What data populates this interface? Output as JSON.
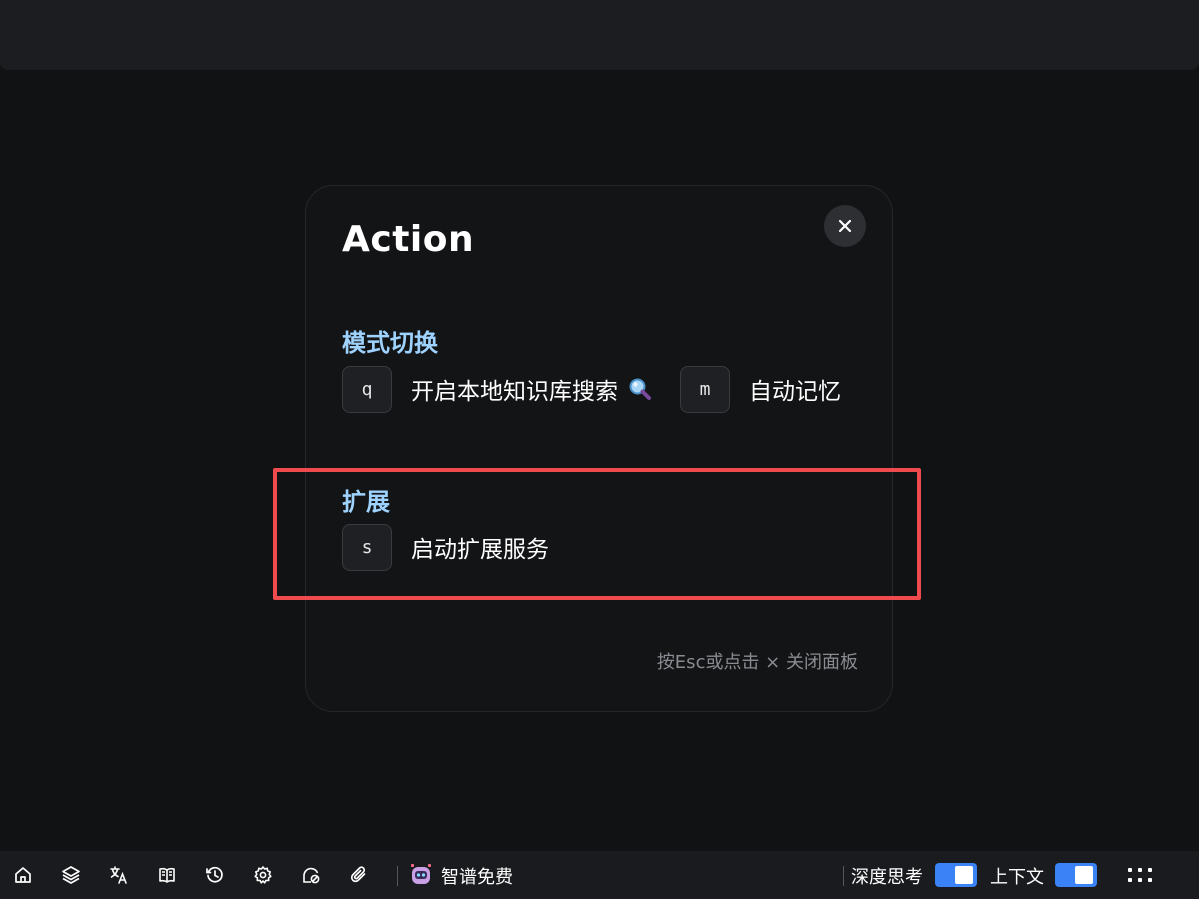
{
  "modal": {
    "title": "Action",
    "close_symbol": "×",
    "sections": [
      {
        "title": "模式切换",
        "items": [
          {
            "key": "q",
            "label": "开启本地知识库搜索",
            "icon": "magnifying-glass-icon"
          },
          {
            "key": "m",
            "label": "自动记忆"
          }
        ]
      },
      {
        "title": "扩展",
        "items": [
          {
            "key": "s",
            "label": "启动扩展服务"
          }
        ]
      }
    ],
    "hint": "按Esc或点击 × 关闭面板"
  },
  "bottom_bar": {
    "icons": [
      "home-icon",
      "layers-icon",
      "translate-icon",
      "book-icon",
      "history-icon",
      "settings-icon",
      "clear-cache-icon",
      "attachment-icon"
    ],
    "model_label": "智谱免费",
    "model_icon": "robot-avatar-icon",
    "deep_think_label": "深度思考",
    "deep_think_enabled": true,
    "context_label": "上下文",
    "context_enabled": true,
    "more_icon": "grid-dots-icon"
  },
  "colors": {
    "accent": "#3b82f6",
    "section_title": "#9fd3ff",
    "highlight": "#ef4b4f",
    "background": "#111214"
  }
}
